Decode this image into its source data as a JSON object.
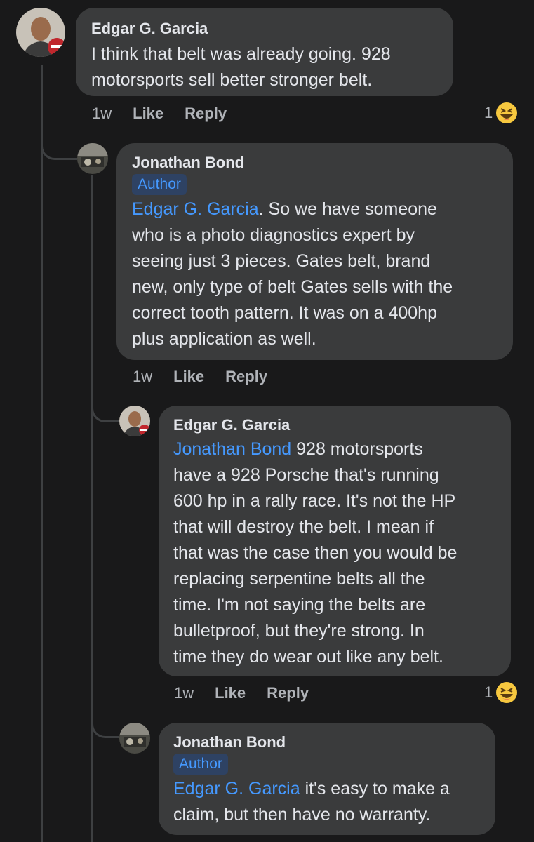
{
  "comments": [
    {
      "author": "Edgar G. Garcia",
      "mention": "",
      "lines": [
        "I think that belt was already going.  928",
        "motorsports sell better stronger belt."
      ],
      "time": "1w",
      "like": "Like",
      "reply": "Reply",
      "reaction_count": "1",
      "reaction_icon": "laughing-emoji-icon"
    },
    {
      "author": "Jonathan Bond",
      "badge": "Author",
      "mention": "Edgar G. Garcia",
      "first_rest": ". So we have someone",
      "lines": [
        "who is a photo diagnostics expert by",
        "seeing just 3 pieces. Gates belt, brand",
        "new, only type of belt Gates sells with the",
        "correct tooth pattern.  It was on a 400hp",
        "plus application as well."
      ],
      "time": "1w",
      "like": "Like",
      "reply": "Reply"
    },
    {
      "author": "Edgar G. Garcia",
      "mention": "Jonathan Bond",
      "first_rest": " 928 motorsports",
      "lines": [
        "have a 928 Porsche that's running",
        "600 hp in a rally race. It's not the HP",
        "that will destroy the belt. I mean if",
        "that was the case then you would be",
        "replacing serpentine belts all the",
        "time.  I'm not saying the belts are",
        "bulletproof, but they're strong.  In",
        "time they do wear out like any belt."
      ],
      "time": "1w",
      "like": "Like",
      "reply": "Reply",
      "reaction_count": "1",
      "reaction_icon": "laughing-emoji-icon"
    },
    {
      "author": "Jonathan Bond",
      "badge": "Author",
      "mention": "Edgar G. Garcia",
      "first_rest": " it's easy to make a",
      "lines": [
        "claim, but then have no warranty."
      ]
    }
  ],
  "colors": {
    "background": "#19191a",
    "bubble": "#3a3b3c",
    "mention": "#4599ff",
    "meta_text": "#b0b3b8"
  }
}
